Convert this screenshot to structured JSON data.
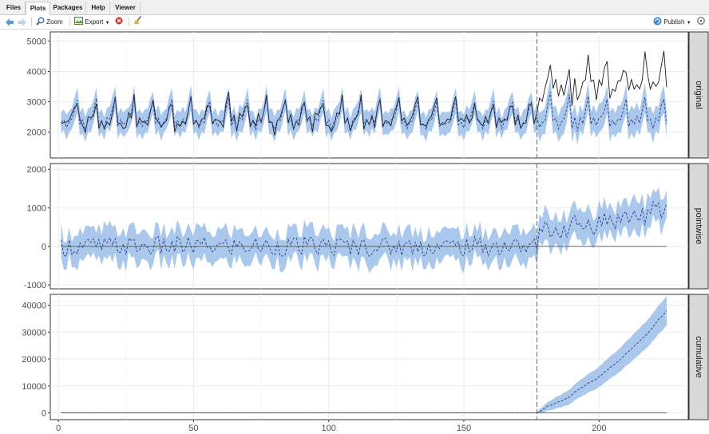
{
  "tabs": [
    {
      "label": "Files",
      "active": false
    },
    {
      "label": "Plots",
      "active": true
    },
    {
      "label": "Packages",
      "active": false
    },
    {
      "label": "Help",
      "active": false
    },
    {
      "label": "Viewer",
      "active": false
    }
  ],
  "toolbar": {
    "zoom_label": "Zoom",
    "export_label": "Export",
    "publish_label": "Publish"
  },
  "colors": {
    "band": "#aac8ec",
    "mean": "#2b3a8a",
    "observed": "#1a1a1a",
    "strip": "#d9d9d9",
    "grid": "#ebebeb",
    "intervention": "#666666"
  },
  "chart_data": {
    "type": "line",
    "x_ticks": [
      0,
      50,
      100,
      150,
      200
    ],
    "xlim": [
      -3,
      233
    ],
    "intervention_x": 177,
    "panels": [
      {
        "strip": "original",
        "ylim": [
          1150,
          5300
        ],
        "y_ticks": [
          2000,
          3000,
          4000,
          5000
        ],
        "y_tick_labels": [
          "2000",
          "3000",
          "4000",
          "5000"
        ],
        "series": [
          {
            "name": "observed",
            "style": "solid black"
          },
          {
            "name": "prediction",
            "style": "dashed blue",
            "band": "95% interval shaded"
          }
        ],
        "key_points": {
          "pre_mean": 2450,
          "post_obs_range": [
            2700,
            5000
          ],
          "post_pred_range": [
            2000,
            3300
          ]
        }
      },
      {
        "strip": "pointwise",
        "ylim": [
          -1100,
          2150
        ],
        "y_ticks": [
          -1000,
          0,
          1000,
          2000
        ],
        "y_tick_labels": [
          "-1000",
          "0",
          "1000",
          "2000"
        ],
        "series": [
          {
            "name": "point effect",
            "style": "dashed blue",
            "band": "shaded"
          }
        ],
        "key_points": {
          "pre_mean": 0,
          "post_range": [
            300,
            1600
          ]
        }
      },
      {
        "strip": "cumulative",
        "ylim": [
          -2500,
          44000
        ],
        "y_ticks": [
          0,
          10000,
          20000,
          30000,
          40000
        ],
        "y_tick_labels": [
          "0",
          "10000",
          "20000",
          "30000",
          "40000"
        ],
        "series": [
          {
            "name": "cumulative effect",
            "style": "dashed blue",
            "band": "shaded"
          }
        ],
        "key_points": {
          "start_value": 0,
          "end_value": 38000,
          "end_band": [
            32000,
            43000
          ]
        }
      }
    ]
  }
}
